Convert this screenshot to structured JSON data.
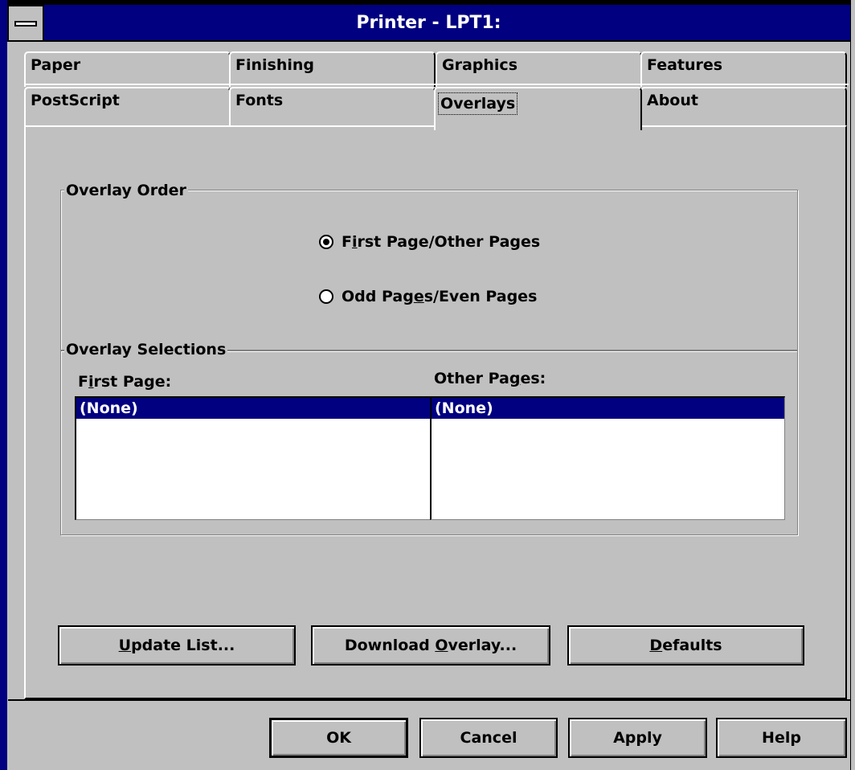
{
  "window": {
    "title": "Printer - LPT1:"
  },
  "tabs": {
    "row1": [
      {
        "label": "Paper"
      },
      {
        "label": "Finishing"
      },
      {
        "label": "Graphics"
      },
      {
        "label": "Features"
      }
    ],
    "row2": [
      {
        "label": "PostScript"
      },
      {
        "label": "Fonts"
      },
      {
        "label": "Overlays",
        "active": true
      },
      {
        "label": "About"
      }
    ]
  },
  "overlay_order": {
    "title": "Overlay Order",
    "options": [
      {
        "label_pre": "F",
        "label_u": "i",
        "label_post": "rst Page/Other Pages",
        "checked": true
      },
      {
        "label_pre": "Odd Pag",
        "label_u": "e",
        "label_post": "s/Even Pages",
        "checked": false
      }
    ]
  },
  "overlay_selections": {
    "title": "Overlay Selections",
    "first_page": {
      "label_pre": "F",
      "label_u": "i",
      "label_post": "rst Page:",
      "selected": "(None)"
    },
    "other_pages": {
      "label_pre": "Other Pa",
      "label_u": "g",
      "label_post": "es:",
      "selected": "(None)"
    }
  },
  "panel_buttons": {
    "update": {
      "u": "U",
      "rest": "pdate List..."
    },
    "download": {
      "pre": "Download ",
      "u": "O",
      "rest": "verlay..."
    },
    "defaults": {
      "u": "D",
      "rest": "efaults"
    }
  },
  "dialog_buttons": {
    "ok": "OK",
    "cancel": "Cancel",
    "apply": "Apply",
    "help": "Help"
  },
  "colors": {
    "titlebar": "#000080",
    "face": "#c0c0c0",
    "selection": "#000080"
  }
}
